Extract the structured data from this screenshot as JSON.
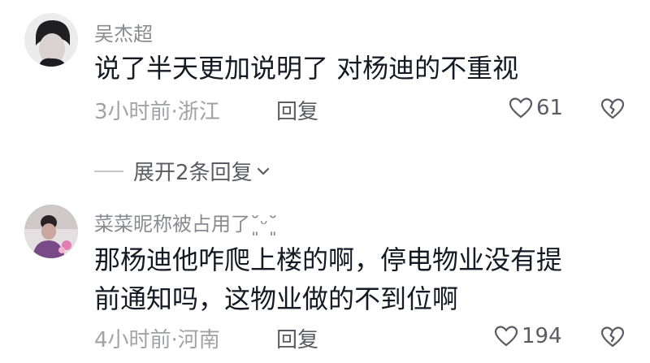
{
  "comments": [
    {
      "username": "吴杰超",
      "text_lines": [
        "说了半天更加说明了 对杨迪的不重视"
      ],
      "time_location": "3小时前·浙江",
      "reply_label": "回复",
      "likes": "61"
    },
    {
      "username": "菜菜昵称被占用了˘͈ᵕ˘͈",
      "text_lines": [
        "那杨迪他咋爬上楼的啊，停电物业没有提",
        "前通知吗，这物业做的不到位啊"
      ],
      "time_location": "4小时前·河南",
      "reply_label": "回复",
      "likes": "194"
    }
  ],
  "expand_replies": {
    "label": "展开2条回复"
  },
  "icons": {
    "like": "heart-outline-icon",
    "dislike": "broken-heart-icon",
    "expand": "chevron-down-icon"
  },
  "colors": {
    "text_primary": "#161823",
    "text_secondary": "#8a8b91",
    "meta": "#a1a2a7"
  }
}
